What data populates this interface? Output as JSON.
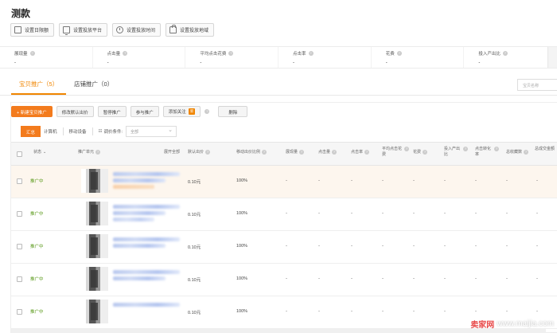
{
  "title": "测款",
  "top_buttons": [
    {
      "label": "设置日限额",
      "icon": "calendar-icon"
    },
    {
      "label": "设置投放平台",
      "icon": "monitor-icon"
    },
    {
      "label": "设置投放时间",
      "icon": "clock-icon"
    },
    {
      "label": "设置投放地域",
      "icon": "bag-icon"
    }
  ],
  "metrics": [
    {
      "label": "展现量",
      "value": "-"
    },
    {
      "label": "点击量",
      "value": "-"
    },
    {
      "label": "平均点击花费",
      "value": "-"
    },
    {
      "label": "点击率",
      "value": "-"
    },
    {
      "label": "花费",
      "value": "-"
    },
    {
      "label": "投入产出比",
      "value": "-"
    }
  ],
  "tabs": {
    "active": "宝贝推广（5）",
    "other": "店铺推广（0）",
    "search_placeholder": "宝贝名称"
  },
  "actions": {
    "new": "+ 新建宝贝推广",
    "modify_bid": "修改默认出价",
    "pause": "暂停推广",
    "resume": "参与推广",
    "attention": "添加关注",
    "attention_badge": "新",
    "delete": "删除"
  },
  "filters": {
    "summary": "汇总",
    "pc": "计算机",
    "mobile": "移动设备",
    "condition_label": "调价条件:",
    "condition_value": "全部"
  },
  "columns": {
    "status": "状态",
    "item": "推广单元",
    "ctr_all": "展开全部",
    "default_bid": "默认出价",
    "mobile_ratio": "移动出价比例",
    "impressions": "展现量",
    "clicks": "点击量",
    "ctr": "点击率",
    "avg_cpc": "平均点击花费",
    "cost": "花费",
    "roi": "投入产出比",
    "conv_rate": "点击转化率",
    "fav": "总收藏数",
    "total_deal": "总成交金额"
  },
  "rows": [
    {
      "status": "推广中",
      "bid": "0.10元",
      "ratio": "100%",
      "dash": "-"
    },
    {
      "status": "推广中",
      "bid": "0.10元",
      "ratio": "100%",
      "dash": "-"
    },
    {
      "status": "推广中",
      "bid": "0.10元",
      "ratio": "100%",
      "dash": "-"
    },
    {
      "status": "推广中",
      "bid": "0.10元",
      "ratio": "100%",
      "dash": "-"
    },
    {
      "status": "推广中",
      "bid": "0.10元",
      "ratio": "100%",
      "dash": "-"
    }
  ],
  "watermark": {
    "cn": "卖家网",
    "url": "www.maijia.com"
  }
}
